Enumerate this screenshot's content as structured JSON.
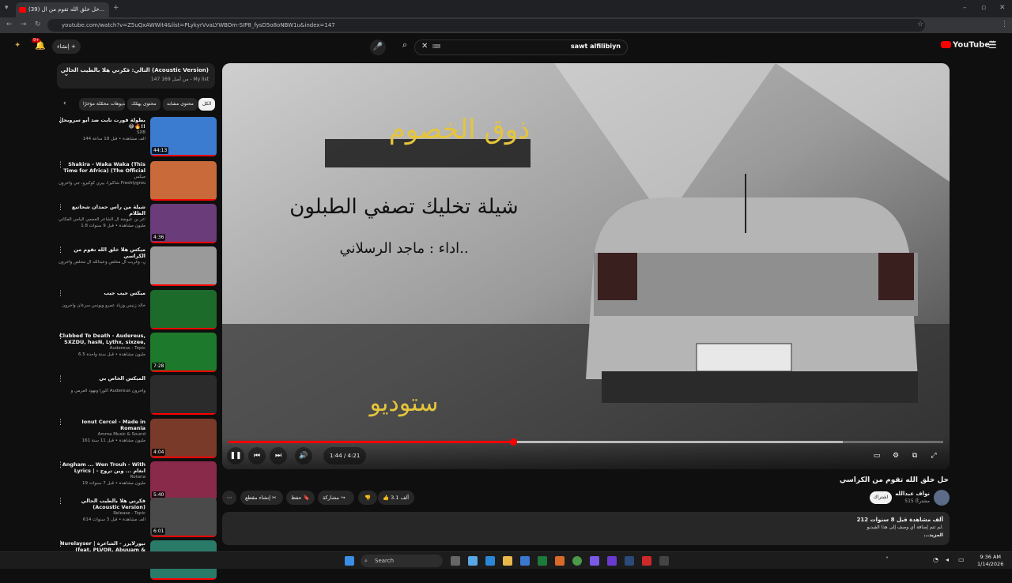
{
  "browser": {
    "tab_title": "(39) خل خلق الله تقوم من ال...",
    "url": "youtube.com/watch?v=Z5uQxAWWit4&list=PLykyrVvaLYWBOm-SIP8_fysD5o8oNBW1u&index=147"
  },
  "header": {
    "search_query": "sawt alfilibiyn",
    "logo_text": "YouTube",
    "logo_region": "SA",
    "create_label": "إنشاء",
    "notif_count": "9+"
  },
  "playlist": {
    "now_title": "التالي: فكرني هلا بالطيب الحالي (Acoustic Version)",
    "position": "147 من أصل 169 - My list",
    "chips": [
      "الكل",
      "محتوى مشابه",
      "محتوى يهمّك",
      "فيديوهات محمّلة مؤخرًا"
    ],
    "items": [
      {
        "title": "بطولة فورت نايت ضد أبو سروبحل 😂🔥!!",
        "channel": "SXB",
        "meta": "144 ألف مشاهدة • قبل 18 ساعة",
        "duration": "44:13",
        "thumb_color": "#3b7bd0"
      },
      {
        "title": "Shakira - Waka Waka (This Time for Africa) (The Official ...",
        "channel": "ميكس",
        "meta": "شاكيرا، بيري كوكيزو، جي وآخرون Freshlyground",
        "duration": "",
        "thumb_color": "#c86a3a"
      },
      {
        "title": "شيلة من رأس حمدان شحاتيع الظلام",
        "channel": "شاعر بن عيوضة آل الشاعر العجمي اليامي العكاني",
        "meta": "1.8 مليون مشاهدة • قبل 9 سنوات",
        "duration": "4:36",
        "thumb_color": "#6a3d7a"
      },
      {
        "title": "ميكس هلا خلق الله تقوم من الكراسي",
        "channel": "ماجد الرسلاني، وغريب آل مخلص وعبدالله آل مخلص وآخرون",
        "meta": "",
        "duration": "",
        "thumb_color": "#9a9a9a"
      },
      {
        "title": "ميكس جيب جيب",
        "channel": "خالد زنيس وزياد عمرو ويونس سرعان وآخرون",
        "meta": "",
        "duration": "",
        "thumb_color": "#1c6b2a"
      },
      {
        "title": "Clubbed To Death - Audereus, SXZDU, hasN, Lythx, sixzee, ...",
        "channel": "Audereus - Topic",
        "meta": "6.5 مليون مشاهدة • قبل سنة واحدة",
        "duration": "7:28",
        "thumb_color": "#1d7a2c"
      },
      {
        "title": "الميكس الخاص بي",
        "channel": "أكورا ونهود العرمي و Audereus وآخرون",
        "meta": "",
        "duration": "",
        "thumb_color": "#2b2b2b"
      },
      {
        "title": "Ionut Cercel - Made in Romania",
        "channel": "Amma Music & Sound",
        "meta": "161 مليون مشاهدة • قبل 11 سنة",
        "duration": "4:04",
        "thumb_color": "#7a3a2a"
      },
      {
        "title": "Angham ... Wen Trouh - With Lyrics | انغام ... وين تروح - بالكلمات",
        "channel": "Rotana",
        "meta": "19 مليون مشاهدة • قبل 7 سنوات",
        "duration": "5:40",
        "thumb_color": "#8a2a4a"
      },
      {
        "title": "فكرني هلا بالطيب الحالي (Acoustic Version)",
        "channel": "Release - Topic",
        "meta": "614 ألف مشاهدة • قبل 3 سنوات",
        "duration": "6:01",
        "thumb_color": "#4a4a4a"
      },
      {
        "title": "Nurelayser | نيورلايزر - الشاعرة (feat. PLVOR, Abuuam & Black ...",
        "channel": "",
        "meta": "",
        "duration": "",
        "thumb_color": "#2a7a6a"
      }
    ]
  },
  "player": {
    "time_current": "1:44",
    "time_total": "4:21",
    "progress_fraction": 0.398,
    "buffered_fraction": 0.86
  },
  "video": {
    "title": "خل خلق الله تقوم من الكراسي",
    "channel": "نواف عبدالله",
    "subscribers": "515 مشتركًا",
    "subscribe_label": "اشتراك",
    "likes": "3.1 ألف",
    "share_label": "مشاركة",
    "save_label": "حفظ",
    "clip_label": "إنشاء مقطع",
    "views_line": "212 ألف مشاهدة  قبل 8 سنوات",
    "desc_line": "لم تتم إضافة أي وصف إلى هذا الفيديو.",
    "more_label": "...المزيد"
  },
  "taskbar": {
    "search_label": "Search",
    "time": "9:36 AM",
    "date": "1/14/2026"
  }
}
